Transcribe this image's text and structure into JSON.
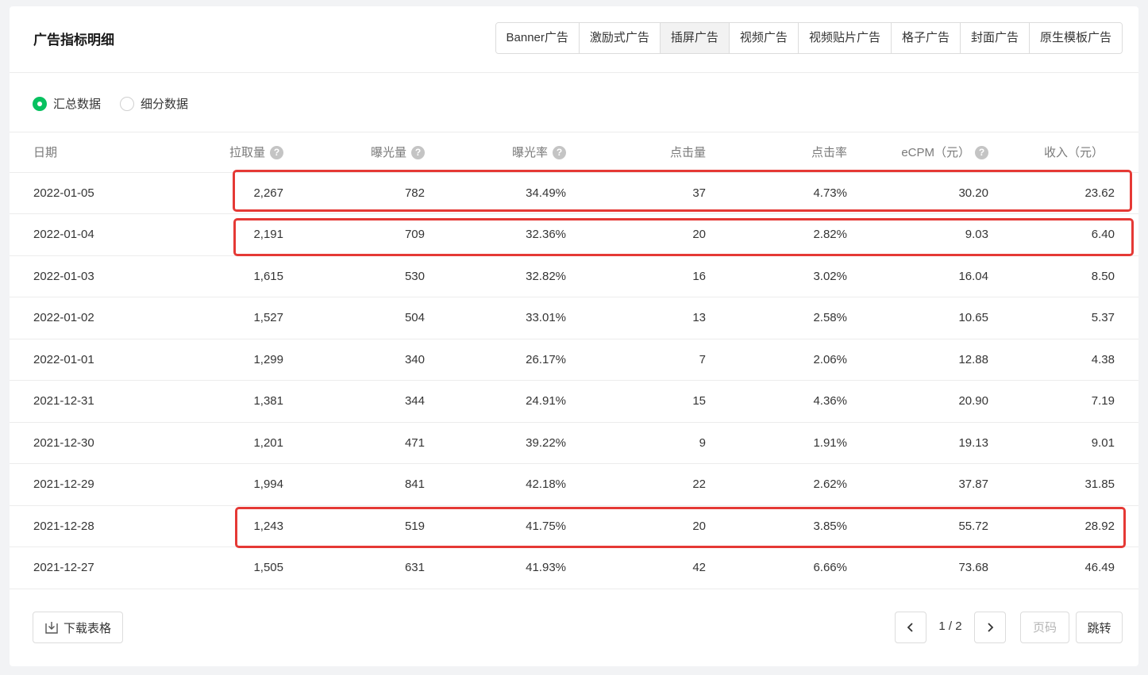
{
  "title": "广告指标明细",
  "tabs": [
    {
      "label": "Banner广告",
      "active": false
    },
    {
      "label": "激励式广告",
      "active": false
    },
    {
      "label": "插屏广告",
      "active": true
    },
    {
      "label": "视频广告",
      "active": false
    },
    {
      "label": "视频贴片广告",
      "active": false
    },
    {
      "label": "格子广告",
      "active": false
    },
    {
      "label": "封面广告",
      "active": false
    },
    {
      "label": "原生模板广告",
      "active": false
    }
  ],
  "filters": {
    "summary_label": "汇总数据",
    "detail_label": "细分数据",
    "selected": "summary"
  },
  "table": {
    "columns": {
      "date": "日期",
      "requests": "拉取量",
      "impressions": "曝光量",
      "impression_rate": "曝光率",
      "clicks": "点击量",
      "ctr": "点击率",
      "ecpm": "eCPM（元）",
      "revenue": "收入（元）"
    },
    "help_icon": "?",
    "rows": [
      {
        "date": "2022-01-05",
        "requests": "2,267",
        "impressions": "782",
        "impression_rate": "34.49%",
        "clicks": "37",
        "ctr": "4.73%",
        "ecpm": "30.20",
        "revenue": "23.62"
      },
      {
        "date": "2022-01-04",
        "requests": "2,191",
        "impressions": "709",
        "impression_rate": "32.36%",
        "clicks": "20",
        "ctr": "2.82%",
        "ecpm": "9.03",
        "revenue": "6.40"
      },
      {
        "date": "2022-01-03",
        "requests": "1,615",
        "impressions": "530",
        "impression_rate": "32.82%",
        "clicks": "16",
        "ctr": "3.02%",
        "ecpm": "16.04",
        "revenue": "8.50"
      },
      {
        "date": "2022-01-02",
        "requests": "1,527",
        "impressions": "504",
        "impression_rate": "33.01%",
        "clicks": "13",
        "ctr": "2.58%",
        "ecpm": "10.65",
        "revenue": "5.37"
      },
      {
        "date": "2022-01-01",
        "requests": "1,299",
        "impressions": "340",
        "impression_rate": "26.17%",
        "clicks": "7",
        "ctr": "2.06%",
        "ecpm": "12.88",
        "revenue": "4.38"
      },
      {
        "date": "2021-12-31",
        "requests": "1,381",
        "impressions": "344",
        "impression_rate": "24.91%",
        "clicks": "15",
        "ctr": "4.36%",
        "ecpm": "20.90",
        "revenue": "7.19"
      },
      {
        "date": "2021-12-30",
        "requests": "1,201",
        "impressions": "471",
        "impression_rate": "39.22%",
        "clicks": "9",
        "ctr": "1.91%",
        "ecpm": "19.13",
        "revenue": "9.01"
      },
      {
        "date": "2021-12-29",
        "requests": "1,994",
        "impressions": "841",
        "impression_rate": "42.18%",
        "clicks": "22",
        "ctr": "2.62%",
        "ecpm": "37.87",
        "revenue": "31.85"
      },
      {
        "date": "2021-12-28",
        "requests": "1,243",
        "impressions": "519",
        "impression_rate": "41.75%",
        "clicks": "20",
        "ctr": "3.85%",
        "ecpm": "55.72",
        "revenue": "28.92"
      },
      {
        "date": "2021-12-27",
        "requests": "1,505",
        "impressions": "631",
        "impression_rate": "41.93%",
        "clicks": "42",
        "ctr": "6.66%",
        "ecpm": "73.68",
        "revenue": "46.49"
      }
    ]
  },
  "footer": {
    "download_label": "下载表格",
    "page_info": "1 / 2",
    "page_input_placeholder": "页码",
    "jump_label": "跳转"
  },
  "colors": {
    "accent": "#07c160",
    "highlight": "#e53935"
  }
}
